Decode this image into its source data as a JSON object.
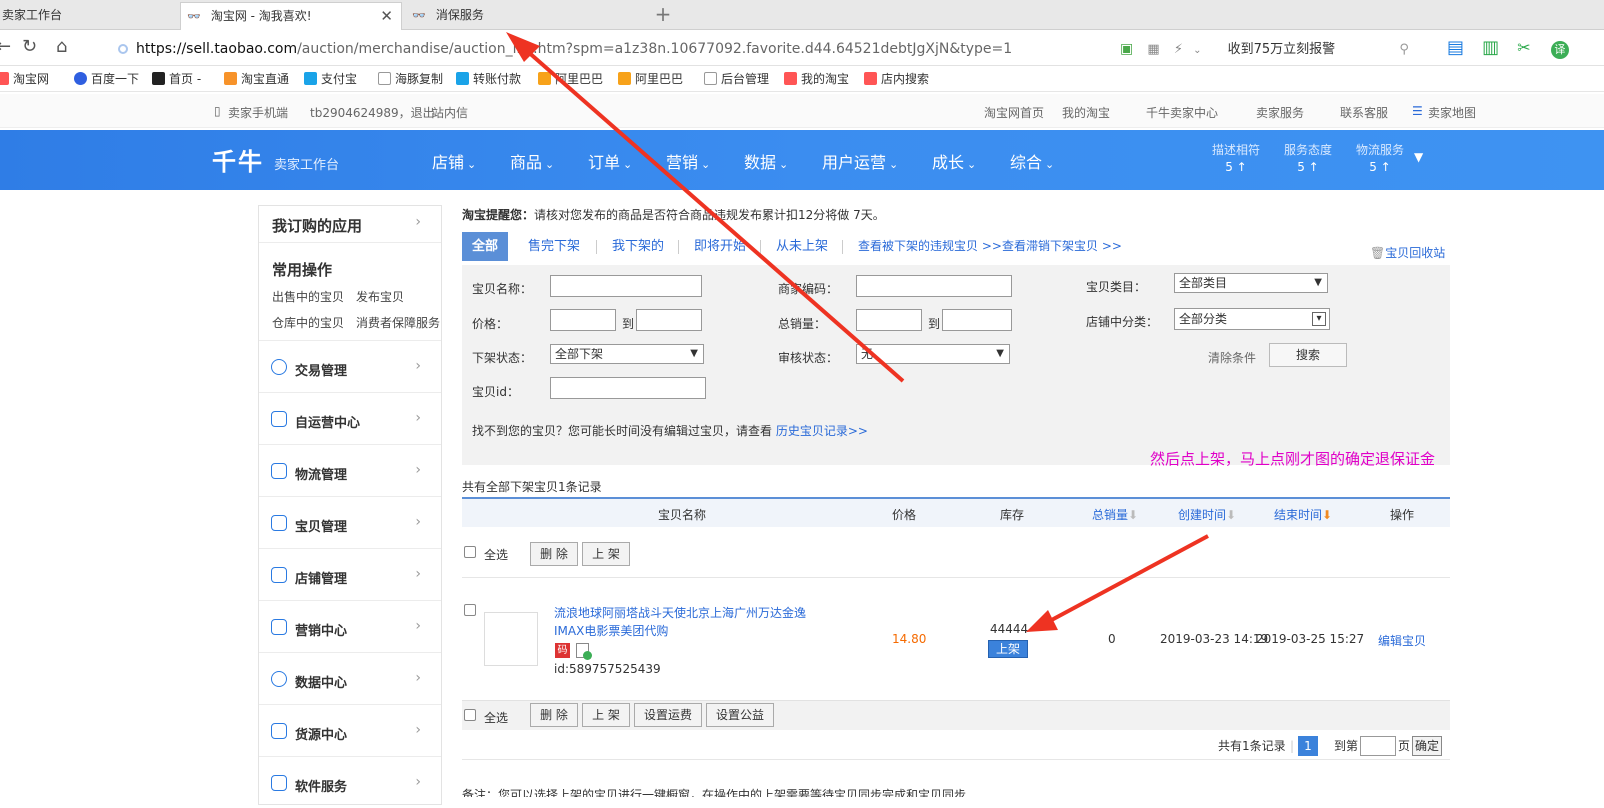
{
  "browser": {
    "tabs": [
      {
        "label": "卖家工作台"
      },
      {
        "label": "淘宝网 - 淘我喜欢!"
      },
      {
        "label": "消保服务"
      }
    ],
    "url_host": "https://sell.taobao.com",
    "url_rest": "/auction/merchandise/auction_list.htm?spm=a1z38n.10677092.favorite.d44.64521debtJgXjN&type=1",
    "address_right_text": "收到75万立刻报警",
    "bookmarks": [
      "淘宝网",
      "百度一下",
      "首页 -",
      "淘宝直通",
      "支付宝",
      "海豚复制",
      "转账付款",
      "阿里巴巴",
      "阿里巴巴",
      "后台管理",
      "我的淘宝",
      "店内搜索"
    ]
  },
  "site_bar": {
    "left": [
      "卖家手机端",
      "tb2904624989，退出",
      "站内信"
    ],
    "right": [
      "淘宝网首页",
      "我的淘宝",
      "千牛卖家中心",
      "卖家服务",
      "联系客服",
      "卖家地图"
    ]
  },
  "header": {
    "logo": "千牛",
    "logo_sub": "卖家工作台",
    "nav": [
      "店铺",
      "商品",
      "订单",
      "营销",
      "数据",
      "用户运营",
      "成长",
      "综合"
    ],
    "stats": [
      {
        "label": "描述相符",
        "value": "5 ↑"
      },
      {
        "label": "服务态度",
        "value": "5 ↑"
      },
      {
        "label": "物流服务",
        "value": "5 ↑"
      }
    ]
  },
  "sidebar": {
    "subscribed": "我订购的应用",
    "common": "常用操作",
    "common_links": [
      "出售中的宝贝",
      "发布宝贝",
      "仓库中的宝贝",
      "消费者保障服务"
    ],
    "items": [
      "交易管理",
      "自运营中心",
      "物流管理",
      "宝贝管理",
      "店铺管理",
      "营销中心",
      "数据中心",
      "货源中心",
      "软件服务"
    ]
  },
  "main": {
    "notice_bold": "淘宝提醒您：",
    "notice_text": "请核对您发布的商品是否符合商品违规发布累计扣12分将做 7天。",
    "tabs": [
      "全部",
      "售完下架",
      "我下架的",
      "即将开始",
      "从未上架"
    ],
    "tab_links": [
      "查看被下架的违规宝贝 >>",
      "查看滞销下架宝贝 >>"
    ],
    "recycle": "宝贝回收站",
    "filter": {
      "name_label": "宝贝名称：",
      "code_label": "商家编码：",
      "category_label": "宝贝类目：",
      "category_value": "全部类目",
      "price_label": "价格：",
      "to": "到",
      "sales_label": "总销量：",
      "shop_cat_label": "店铺中分类：",
      "shop_cat_value": "全部分类",
      "status_label": "下架状态：",
      "status_value": "全部下架",
      "audit_label": "审核状态：",
      "audit_value": "无",
      "clear": "清除条件",
      "search": "搜索",
      "id_label": "宝贝id：",
      "history_text": "找不到您的宝贝？您可能长时间没有编辑过宝贝，请查看",
      "history_link": "历史宝贝记录>>"
    },
    "tip": "然后点上架，马上点刚才图的确定退保证金",
    "count": "共有全部下架宝贝1条记录",
    "columns": [
      "宝贝名称",
      "价格",
      "库存",
      "总销量",
      "创建时间",
      "结束时间",
      "操作"
    ],
    "select_all": "全选",
    "delete": "删 除",
    "shelve": "上 架",
    "set_shipping": "设置运费",
    "set_charity": "设置公益",
    "item": {
      "title_line1": "流浪地球阿丽塔战斗天使北京上海广州万达金逸",
      "title_line2": "IMAX电影票美团代购",
      "badge": "码",
      "id": "id:589757525439",
      "price": "14.80",
      "stock": "44444",
      "shelve_btn": "上架",
      "sales": "0",
      "created": "2019-03-23 14:19",
      "ends": "2019-03-25 15:27",
      "edit": "编辑宝贝"
    },
    "pager": {
      "total": "共有1条记录",
      "current": "1",
      "goto": "到第",
      "page": "页",
      "confirm": "确定"
    },
    "footnote": "备注：您可以选择上架的宝贝进行一键橱窗，在操作中的上架需要等待宝贝同步完成和宝贝同步"
  },
  "colors": {
    "accent": "#3b8df0",
    "link": "#2a6ad8",
    "tip": "#e000c8",
    "price": "#f56a00",
    "arrow": "#ee3322"
  }
}
